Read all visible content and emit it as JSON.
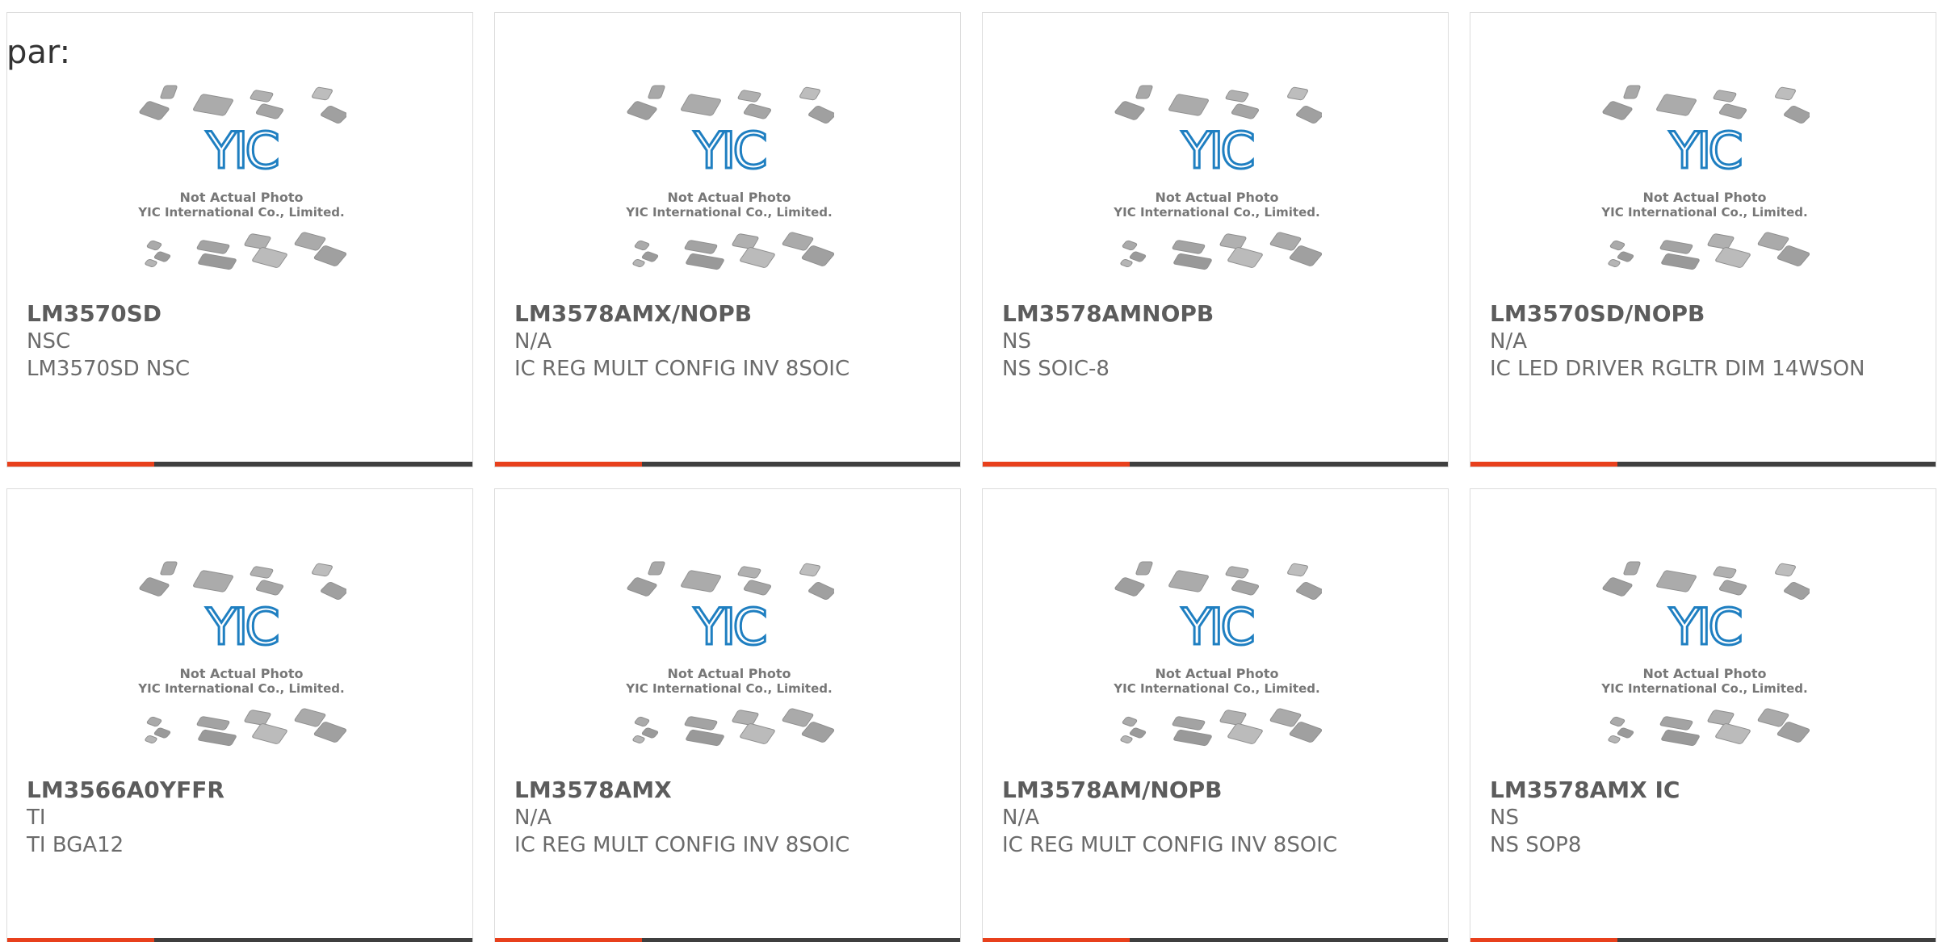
{
  "heading": "par:",
  "colors": {
    "accent": "#e8401c",
    "bar_dark": "#3f3f3f",
    "logo_blue": "#1f7fc1"
  },
  "placeholder_image": {
    "line1": "Not Actual Photo",
    "line2": "YIC International Co., Limited.",
    "logo_text": "YIC"
  },
  "products": [
    {
      "part": "LM3570SD",
      "maker": "NSC",
      "desc": "LM3570SD NSC"
    },
    {
      "part": "LM3578AMX/NOPB",
      "maker": "N/A",
      "desc": "IC REG MULT CONFIG INV 8SOIC"
    },
    {
      "part": "LM3578AMNOPB",
      "maker": "NS",
      "desc": "NS SOIC-8"
    },
    {
      "part": "LM3570SD/NOPB",
      "maker": "N/A",
      "desc": "IC LED DRIVER RGLTR DIM 14WSON"
    },
    {
      "part": "LM3566A0YFFR",
      "maker": "TI",
      "desc": "TI BGA12"
    },
    {
      "part": "LM3578AMX",
      "maker": "N/A",
      "desc": "IC REG MULT CONFIG INV 8SOIC"
    },
    {
      "part": "LM3578AM/NOPB",
      "maker": "N/A",
      "desc": "IC REG MULT CONFIG INV 8SOIC"
    },
    {
      "part": "LM3578AMX IC",
      "maker": "NS",
      "desc": "NS SOP8"
    }
  ]
}
